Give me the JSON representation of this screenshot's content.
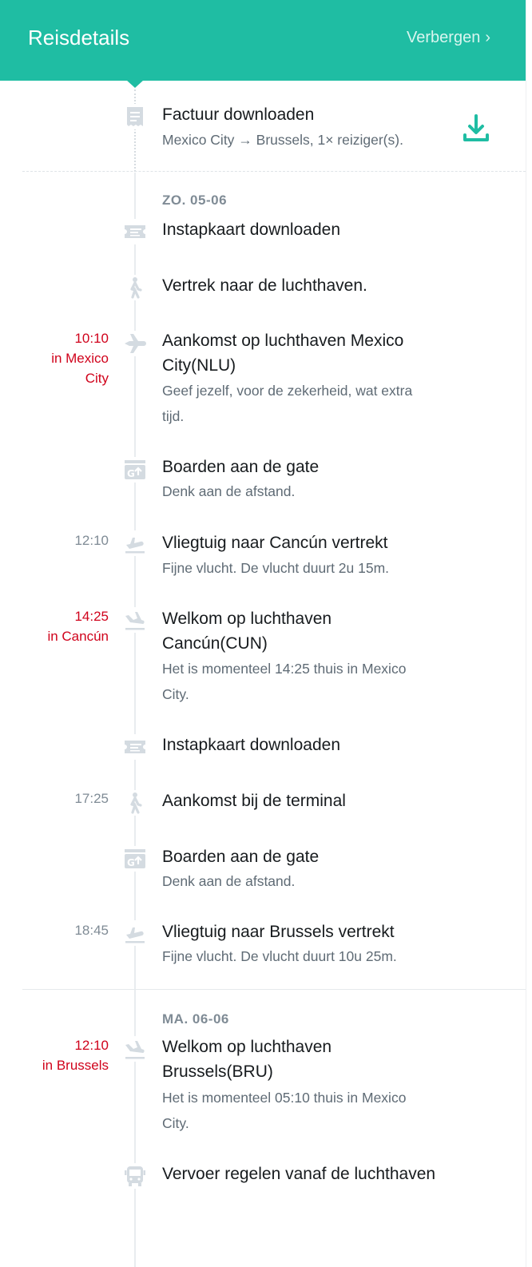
{
  "header": {
    "title": "Reisdetails",
    "hide_label": "Verbergen",
    "hide_chevron": "›"
  },
  "invoice": {
    "title": "Factuur downloaden",
    "subtitle": "Mexico City → Brussels, 1× reiziger(s).",
    "icon": "receipt-icon",
    "action_icon": "download-icon"
  },
  "days": [
    {
      "date": "ZO. 05-06"
    },
    {
      "date": "MA. 06-06"
    }
  ],
  "events": [
    {
      "icon": "boarding-pass-icon",
      "time": "",
      "title": "Instapkaart downloaden",
      "subtitle": ""
    },
    {
      "icon": "walking-person-icon",
      "time": "",
      "title": "Vertrek naar de luchthaven.",
      "subtitle": ""
    },
    {
      "icon": "airplane-icon",
      "time": "10:10",
      "time_location": "in Mexico City",
      "title_line1": "Aankomst op luchthaven Mexico",
      "title_line2": "City(NLU)",
      "subtitle_line1": "Geef jezelf, voor de zekerheid, wat extra",
      "subtitle_line2": "tijd."
    },
    {
      "icon": "gate-icon",
      "time": "",
      "title": "Boarden aan de gate",
      "subtitle": "Denk aan de afstand."
    },
    {
      "icon": "takeoff-icon",
      "time": "12:10",
      "title": "Vliegtuig naar Cancún vertrekt",
      "subtitle": "Fijne vlucht. De vlucht duurt 2u 15m."
    },
    {
      "icon": "landing-icon",
      "time": "14:25",
      "time_location": "in Cancún",
      "title_line1": "Welkom op luchthaven",
      "title_line2": "Cancún(CUN)",
      "subtitle_line1": "Het is momenteel 14:25 thuis in Mexico",
      "subtitle_line2": "City."
    },
    {
      "icon": "boarding-pass-icon",
      "time": "",
      "title": "Instapkaart downloaden",
      "subtitle": ""
    },
    {
      "icon": "walking-person-icon",
      "time": "17:25",
      "title": "Aankomst bij de terminal",
      "subtitle": ""
    },
    {
      "icon": "gate-icon",
      "time": "",
      "title": "Boarden aan de gate",
      "subtitle": "Denk aan de afstand."
    },
    {
      "icon": "takeoff-icon",
      "time": "18:45",
      "title": "Vliegtuig naar Brussels vertrekt",
      "subtitle": "Fijne vlucht. De vlucht duurt 10u 25m."
    },
    {
      "icon": "landing-icon",
      "time": "12:10",
      "time_location": "in Brussels",
      "title_line1": "Welkom op luchthaven",
      "title_line2": "Brussels(BRU)",
      "subtitle_line1": "Het is momenteel 05:10 thuis in Mexico",
      "subtitle_line2": "City."
    },
    {
      "icon": "bus-icon",
      "time": "",
      "title": "Vervoer regelen vanaf de luchthaven",
      "subtitle": ""
    }
  ],
  "colors": {
    "accent": "#1fbda3",
    "alert_time": "#d0021b",
    "icon_gray": "#d4dbe1"
  }
}
